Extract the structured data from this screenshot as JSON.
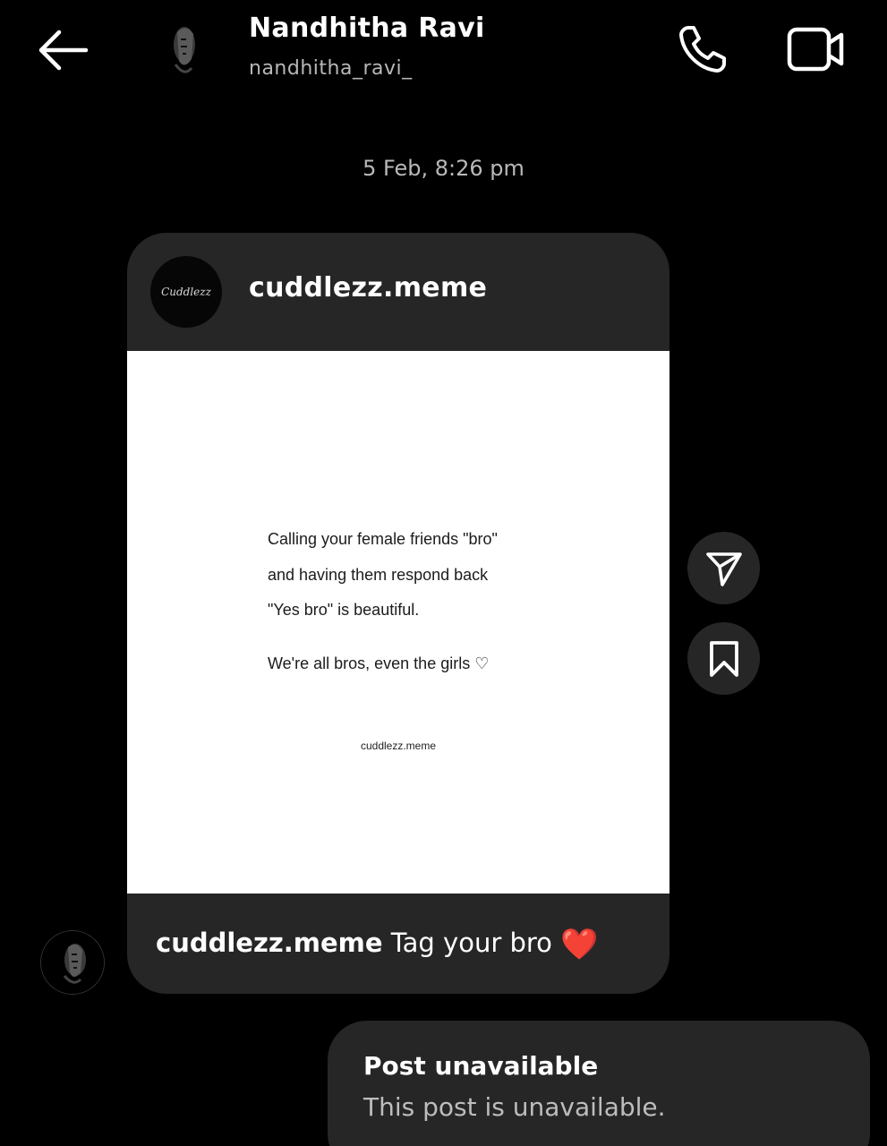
{
  "header": {
    "contact_name": "Nandhitha Ravi",
    "contact_username": "nandhitha_ravi_",
    "icons": [
      "back-arrow-icon",
      "phone-icon",
      "video-camera-icon"
    ]
  },
  "chat": {
    "timestamp": "5 Feb, 8:26 pm",
    "shared_post": {
      "account": "cuddlezz.meme",
      "avatar_text": "Cuddlezz",
      "image_text": {
        "line1": "Calling your female friends \"bro\"",
        "line2": "and having them respond back",
        "line3": "\"Yes bro\" is beautiful.",
        "line4": "We're all bros, even the girls ♡",
        "watermark": "cuddlezz.meme"
      },
      "caption_account": "cuddlezz.meme",
      "caption_text": "Tag your bro",
      "caption_emoji": "❤️"
    },
    "side_actions": [
      "send-icon",
      "bookmark-icon"
    ],
    "reply": {
      "title": "Post unavailable",
      "subtitle": "This post is unavailable."
    }
  },
  "colors": {
    "background": "#000000",
    "bubble": "#262626",
    "secondary_text": "#b8b8b8",
    "heart": "#ec1c24"
  }
}
